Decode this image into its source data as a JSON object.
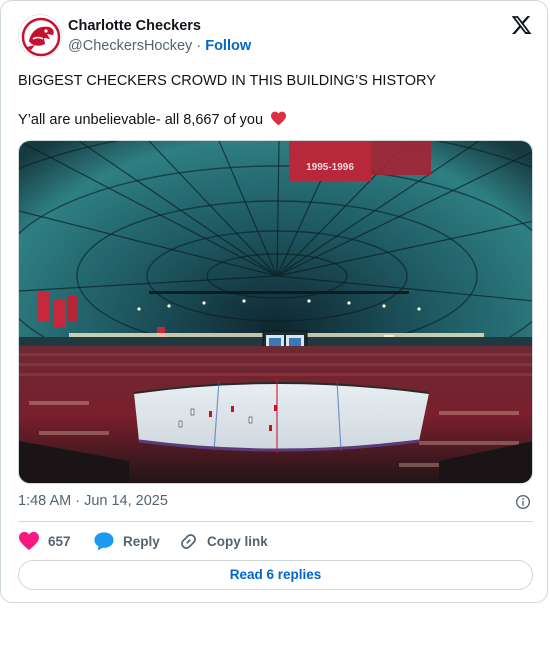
{
  "author": {
    "name": "Charlotte Checkers",
    "handle": "@CheckersHockey",
    "separator": "·",
    "follow_label": "Follow"
  },
  "post": {
    "line1": "BIGGEST CHECKERS CROWD IN THIS BUILDING’S HISTORY",
    "line2": "Y’all are unbelievable- all 8,667 of you",
    "emoji": "red-heart",
    "timestamp": "1:48 AM · Jun 14, 2025"
  },
  "media": {
    "banners": [
      "1995-1996"
    ]
  },
  "actions": {
    "like_count": "657",
    "reply_label": "Reply",
    "copy_label": "Copy link"
  },
  "replies_button": "Read 6 replies",
  "colors": {
    "like_pink": "#f91880",
    "reply_blue": "#1d9bf0",
    "link_blue": "#0066cc",
    "heart_red": "#e0245e"
  }
}
